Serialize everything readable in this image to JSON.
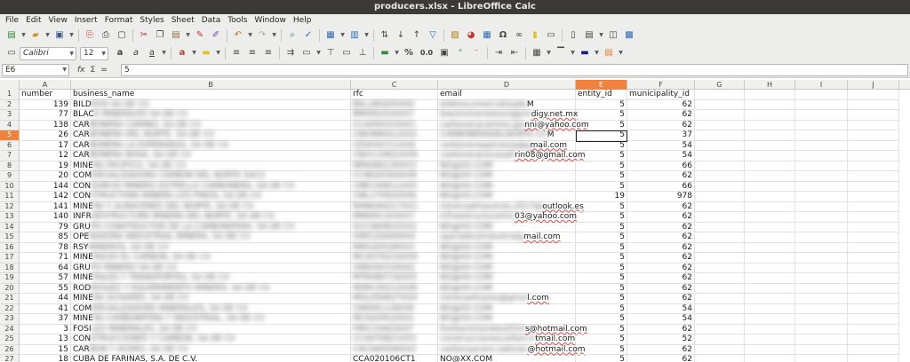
{
  "window": {
    "title": "producers.xlsx - LibreOffice Calc"
  },
  "menu": [
    "File",
    "Edit",
    "View",
    "Insert",
    "Format",
    "Styles",
    "Sheet",
    "Data",
    "Tools",
    "Window",
    "Help"
  ],
  "toolbar1": {
    "icons": [
      "new-document-icon",
      "open-folder-icon",
      "save-icon",
      "export-pdf-icon",
      "print-icon",
      "print-preview-icon",
      "cut-icon",
      "copy-icon",
      "paste-icon",
      "clone-formatting-icon",
      "clear-formatting-icon",
      "undo-icon",
      "redo-icon",
      "find-replace-icon",
      "spelling-icon",
      "row-icon",
      "column-icon",
      "sort-icon",
      "sort-ascending-icon",
      "sort-descending-icon",
      "autofilter-icon",
      "image-icon",
      "chart-icon",
      "pivot-table-icon",
      "special-character-icon",
      "hyperlink-icon",
      "comment-icon",
      "header-footer-icon",
      "define-print-area-icon",
      "freeze-icon",
      "split-window-icon",
      "show-draw-icon"
    ]
  },
  "toolbar2": {
    "font_name": "Calibri",
    "font_size": "12",
    "percent_label": "%",
    "decimal_label": "0.0"
  },
  "formula_bar": {
    "name_box": "E6",
    "sum_label": "Σ",
    "equals_label": "=",
    "content": "5"
  },
  "columns": [
    {
      "letter": "A",
      "header": "number"
    },
    {
      "letter": "B",
      "header": "business_name"
    },
    {
      "letter": "C",
      "header": "rfc"
    },
    {
      "letter": "D",
      "header": "email"
    },
    {
      "letter": "E",
      "header": "entity_id"
    },
    {
      "letter": "F",
      "header": "municipality_id"
    },
    {
      "letter": "G",
      "header": ""
    },
    {
      "letter": "H",
      "header": ""
    },
    {
      "letter": "I",
      "header": ""
    },
    {
      "letter": "J",
      "header": ""
    }
  ],
  "rows": [
    {
      "n": "2",
      "number": "139",
      "bn_vis": "BILD",
      "bn_blur": "ROS SA DE CV",
      "rfc_blur": "BSL180205XX0",
      "em_blur": "bildroscomercializado",
      "em_vis": "M",
      "entity": "5",
      "mun": "62"
    },
    {
      "n": "3",
      "number": "77",
      "bn_vis": "BLAC",
      "bn_blur": "K MINERALES SA DE CV",
      "rfc_blur": "BMI091016XX7",
      "em_blur": "blackmineralesxx@pro",
      "em_vis": "digy.net.mx",
      "entity": "5",
      "mun": "62"
    },
    {
      "n": "4",
      "number": "138",
      "bn_vis": "CAR",
      "bn_blur": "BONERA CAMINO, SA DE CV",
      "rfc_blur": "CCA050315XX1",
      "em_blur": "carboneracamino.gia",
      "em_vis": "nni@yahoo.com",
      "entity": "5",
      "mun": "62"
    },
    {
      "n": "5",
      "number": "26",
      "bn_vis": "CAR",
      "bn_blur": "BONERA DEL NORTE, SA DE CV",
      "rfc_blur": "CNO990412XX2",
      "em_blur": "CARBONERADELNORTE.CO",
      "em_vis": "M",
      "entity": "5",
      "mun": "37"
    },
    {
      "n": "6",
      "number": "17",
      "bn_vis": "CAR",
      "bn_blur": "BONERA LA ESPERANZA, SA DE CV",
      "rfc_blur": "CES030711XX4",
      "em_blur": "carbonerasperanza@g",
      "em_vis": "mail.com",
      "entity": "5",
      "mun": "54"
    },
    {
      "n": "7",
      "number": "12",
      "bn_vis": "CAR",
      "bn_blur": "BONERA NOVA, SA DE CV",
      "rfc_blur": "CNO110822XX9",
      "em_blur": "carboneranovasalt",
      "em_vis": "rin08@gmail.com",
      "entity": "5",
      "mun": "54"
    },
    {
      "n": "8",
      "number": "19",
      "bn_vis": "MINE",
      "bn_blur": "RA PACIFICO, SA DE CV",
      "rfc_blur": "MPA080130XX3",
      "em_blur": "NO@XX.COM",
      "em_vis": "",
      "entity": "5",
      "mun": "66"
    },
    {
      "n": "9",
      "number": "20",
      "bn_vis": "COM",
      "bn_blur": "ERCIALIZADORA CARBON DEL NORTE SACV",
      "rfc_blur": "CCN020304XX8",
      "em_blur": "NO@XX.COM",
      "em_vis": "",
      "entity": "5",
      "mun": "62"
    },
    {
      "n": "10",
      "number": "144",
      "bn_vis": "CON",
      "bn_blur": "SORCIO MINERO ESTRELLA CARBONERA, SA DE CV",
      "rfc_blur": "CME150611XX5",
      "em_blur": "NO@XX.COM",
      "em_vis": "",
      "entity": "5",
      "mun": "66"
    },
    {
      "n": "11",
      "number": "142",
      "bn_vis": "CON",
      "bn_blur": "STRUCTORA MINERA LOS PINOS, SA DE CV",
      "rfc_blur": "CML170925XX6",
      "em_blur": "NO@XX.COM",
      "em_vis": "",
      "entity": "19",
      "mun": "978"
    },
    {
      "n": "12",
      "number": "141",
      "bn_vis": "MINE",
      "bn_blur": "RA Y ALMACENES DEL NORTE, SA DE CV",
      "rfc_blur": "MAN040217XX1",
      "em_blur": "mineraalmacenes.2017@",
      "em_vis": "outlook.es",
      "entity": "5",
      "mun": "62"
    },
    {
      "n": "13",
      "number": "140",
      "bn_vis": "INFR",
      "bn_blur": "AESTRUCTURA MINERA DEL NORTE, SA DE CV",
      "rfc_blur": "IMN091103XX7",
      "em_blur": "infraestructuramin",
      "em_vis": "03@yahoo.com",
      "entity": "5",
      "mun": "62"
    },
    {
      "n": "14",
      "number": "79",
      "bn_vis": "GRU",
      "bn_blur": "PO CONSTRUCTOR DE LA CARBONIFERA, SA DE CV",
      "rfc_blur": "GCC060815XX2",
      "em_blur": "NO@XX.COM",
      "em_vis": "",
      "entity": "5",
      "mun": "62"
    },
    {
      "n": "15",
      "number": "85",
      "bn_vis": "OPE",
      "bn_blur": "RADORA INDUSTRIAL MINERA, SA DE CV",
      "rfc_blur": "OIM120409XX4",
      "em_blur": "operadoraindustrialg",
      "em_vis": "mail.com",
      "entity": "5",
      "mun": "62"
    },
    {
      "n": "16",
      "number": "78",
      "bn_vis": "RSY",
      "bn_blur": "MINEROS, SA DE CV",
      "rfc_blur": "RMI100528XX3",
      "em_blur": "NO@XX.COM",
      "em_vis": "",
      "entity": "5",
      "mun": "62"
    },
    {
      "n": "17",
      "number": "71",
      "bn_vis": "MINE",
      "bn_blur": "RALES EL CARBON, SA DE CV",
      "rfc_blur": "MCA070214XX9",
      "em_blur": "NO@XX.COM",
      "em_vis": "",
      "entity": "5",
      "mun": "62"
    },
    {
      "n": "18",
      "number": "64",
      "bn_vis": "GRU",
      "bn_blur": "PO MINERO SA DE CV",
      "rfc_blur": "GMI030319XX2",
      "em_blur": "NO@XX.COM",
      "em_vis": "",
      "entity": "5",
      "mun": "62"
    },
    {
      "n": "19",
      "number": "57",
      "bn_vis": "MINE",
      "bn_blur": "RALES Y TRANSPORTES, SA DE CV",
      "rfc_blur": "MTR080716XX5",
      "em_blur": "NO@XX.COM",
      "em_vis": "",
      "entity": "5",
      "mun": "62"
    },
    {
      "n": "20",
      "number": "55",
      "bn_vis": "ROD",
      "bn_blur": "RIGUEZ Y EQUIPAMIENTO MINERO, SA DE CV",
      "rfc_blur": "REM130212XX8",
      "em_blur": "NO@XX.COM",
      "em_vis": "",
      "entity": "5",
      "mun": "62"
    },
    {
      "n": "21",
      "number": "44",
      "bn_vis": "MINE",
      "bn_blur": "RA OLIVARES, SA DE CV",
      "rfc_blur": "MOL050627XX4",
      "em_blur": "mineraolivares@gmai",
      "em_vis": "l.com",
      "entity": "5",
      "mun": "62"
    },
    {
      "n": "22",
      "number": "41",
      "bn_vis": "COM",
      "bn_blur": "ERCIALIZADORA MINERALES, SA DE CV",
      "rfc_blur": "CMI091118XX6",
      "em_blur": "NO@XX.COM",
      "em_vis": "",
      "entity": "5",
      "mun": "54"
    },
    {
      "n": "23",
      "number": "37",
      "bn_vis": "MINE",
      "bn_blur": "RA CARBONIFERA Y INDUSTRIAL, SA DE CV",
      "rfc_blur": "MCI020910XX1",
      "em_blur": "NO@XX.COM",
      "em_vis": "",
      "entity": "5",
      "mun": "54"
    },
    {
      "n": "24",
      "number": "3",
      "bn_vis": "FOSI",
      "bn_blur": "LES MINERALES, SA DE CV",
      "rfc_blur": "FMI110403XX7",
      "em_blur": "fosilesminerales2010",
      "em_vis": "s@hotmail.com",
      "entity": "5",
      "mun": "62"
    },
    {
      "n": "25",
      "number": "13",
      "bn_vis": "CON",
      "bn_blur": "STRUCCIONES Y CARBON, SA DE CV",
      "rfc_blur": "CCA070821XX3",
      "em_blur": "construccionescarbon.h",
      "em_vis": "tmail.com",
      "entity": "5",
      "mun": "52"
    },
    {
      "n": "26",
      "number": "15",
      "bn_vis": "CAR",
      "bn_blur": "BON Y ACERO, SA DE CV",
      "rfc_blur": "CAC040506XX2",
      "em_blur": "carbonyacero.sabinas",
      "em_vis": "@hotmail.com",
      "entity": "5",
      "mun": "62"
    },
    {
      "n": "27",
      "number": "18",
      "bn_vis": "CUBA DE FARINAS, S.A. DE C.V.",
      "bn_blur": "",
      "rfc_blur": "CCA020106CT1",
      "em_blur": "",
      "em_vis": "NO@XX.COM",
      "entity": "5",
      "mun": "62"
    }
  ]
}
